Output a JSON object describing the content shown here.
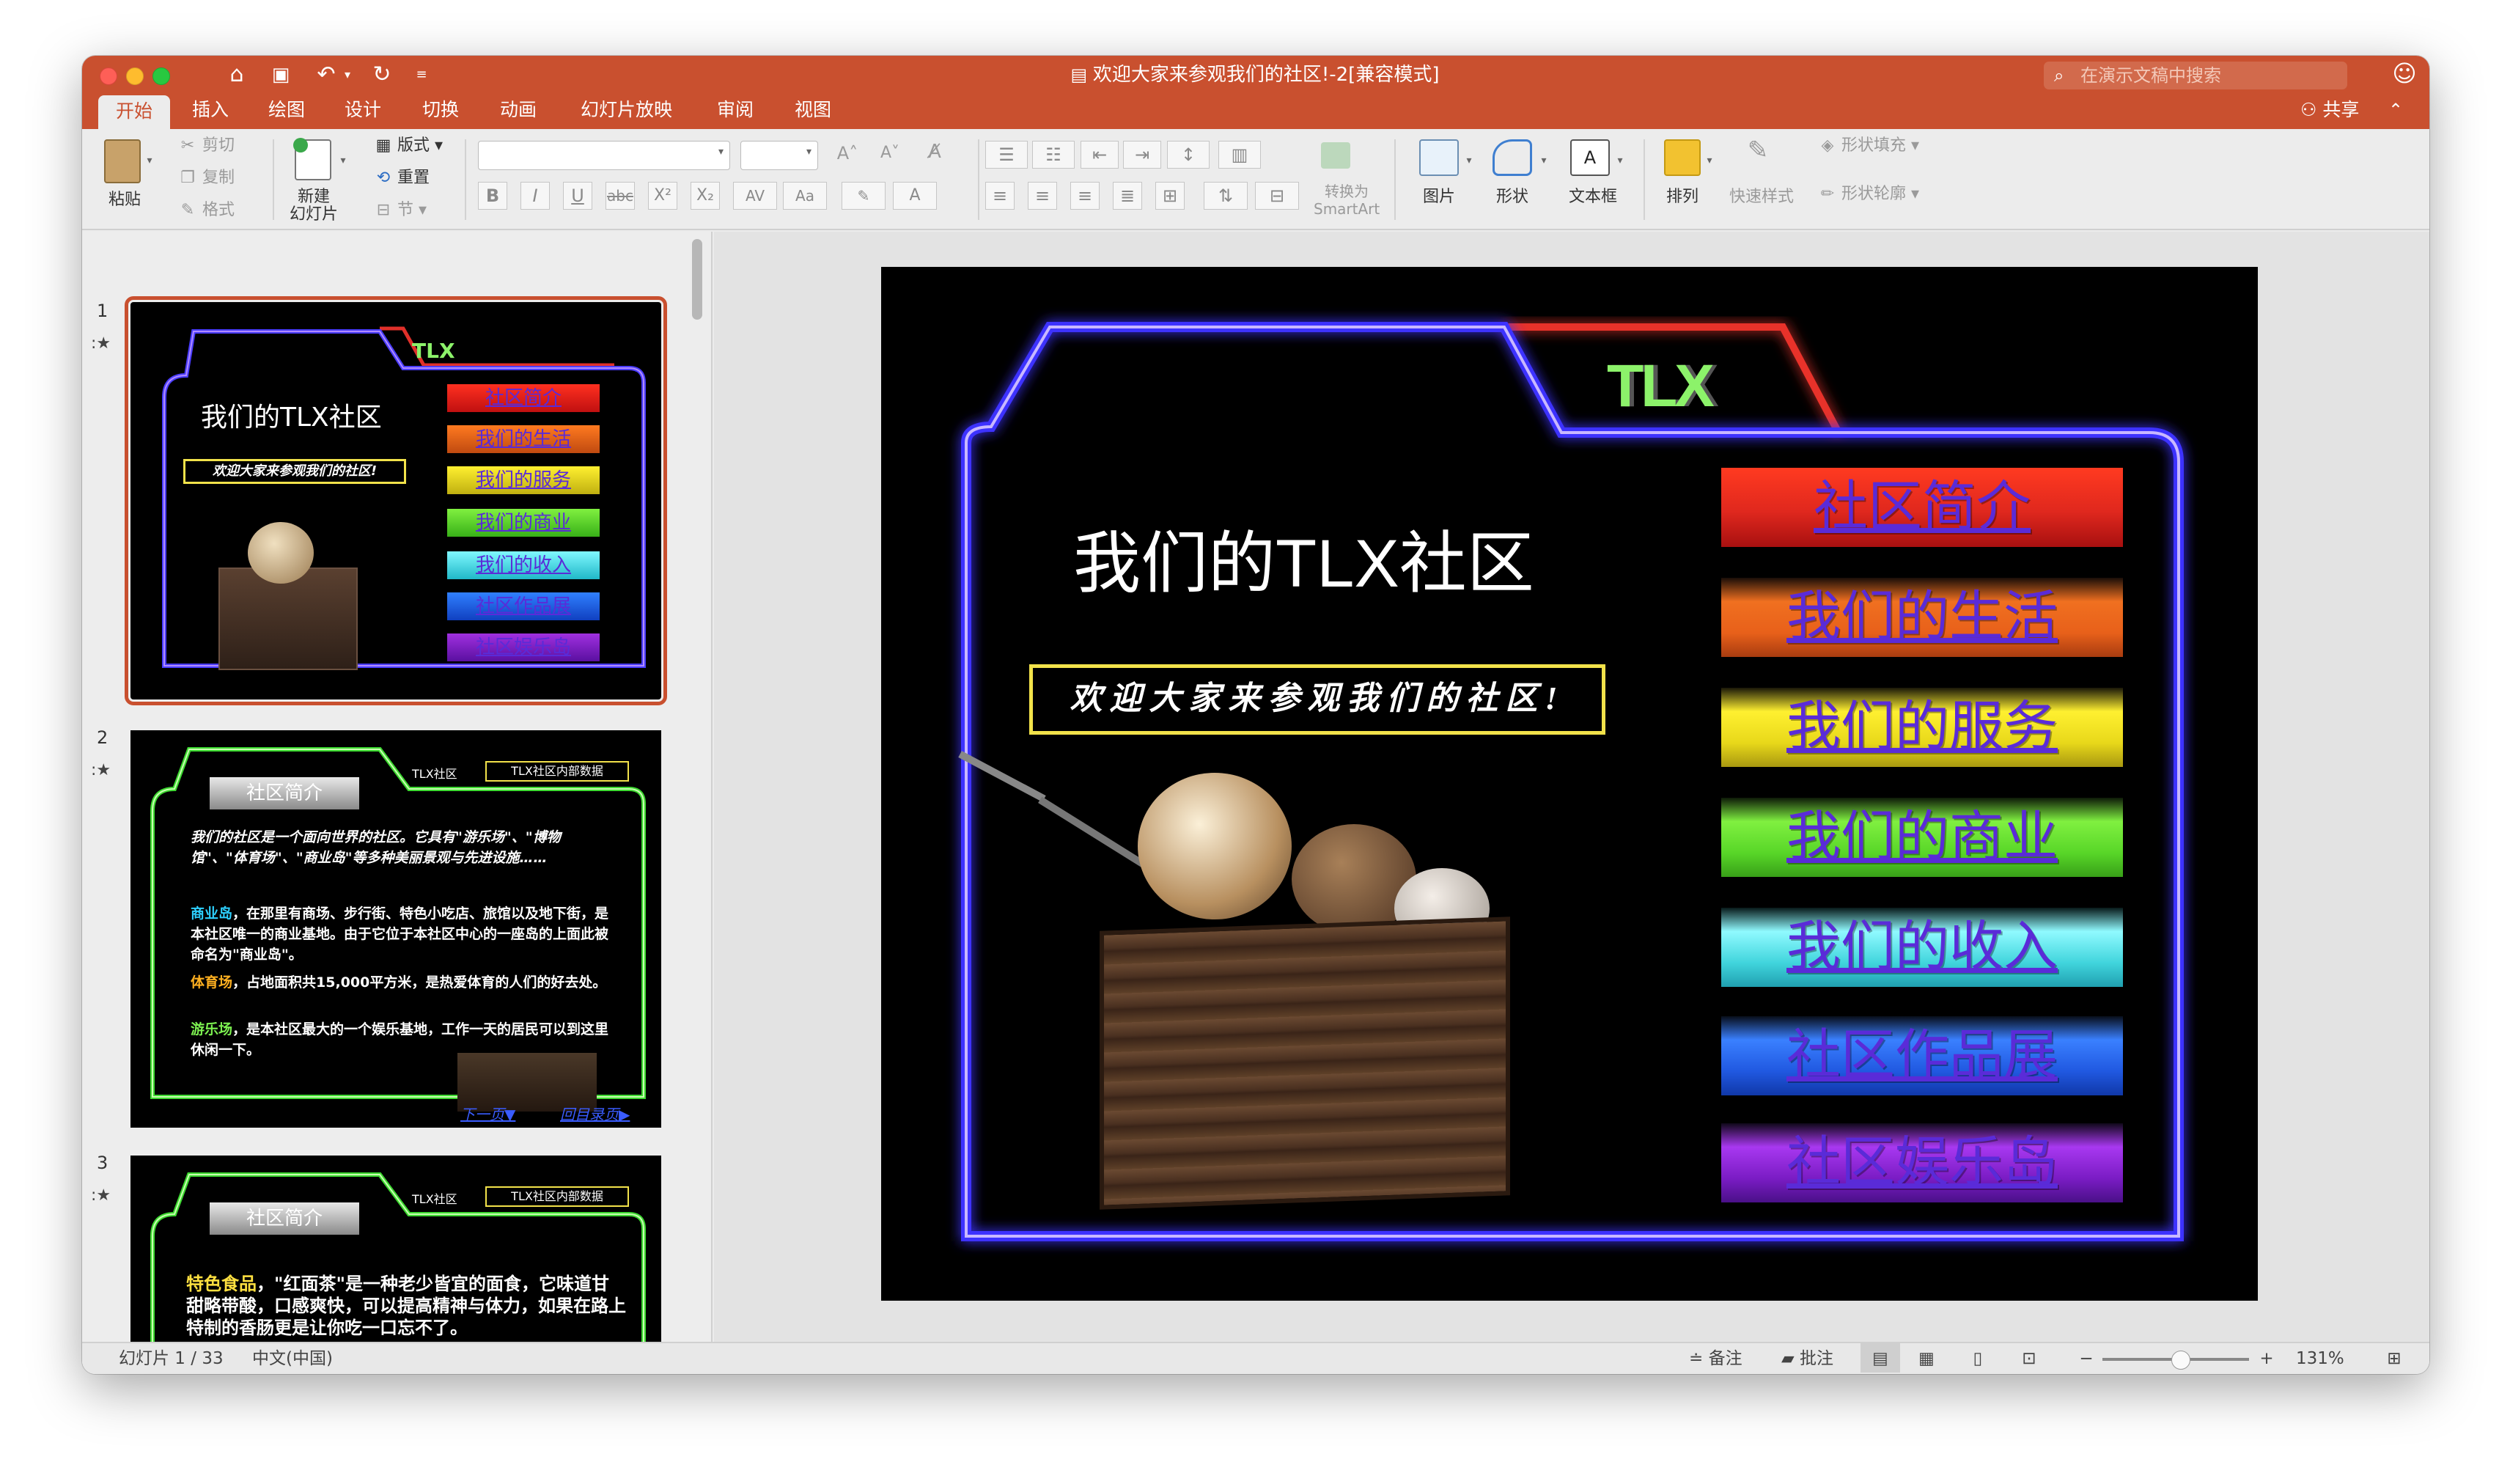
{
  "window": {
    "title": "欢迎大家来参观我们的社区!-2[兼容模式]",
    "search_placeholder": "在演示文稿中搜索"
  },
  "tabs": [
    "开始",
    "插入",
    "绘图",
    "设计",
    "切换",
    "动画",
    "幻灯片放映",
    "审阅",
    "视图"
  ],
  "share_label": "共享",
  "ribbon": {
    "paste": "粘贴",
    "cut": "剪切",
    "copy": "复制",
    "format": "格式",
    "new_slide_line1": "新建",
    "new_slide_line2": "幻灯片",
    "layout": "版式",
    "reset": "重置",
    "section": "节",
    "convert_line1": "转换为",
    "convert_line2": "SmartArt",
    "picture": "图片",
    "shape": "形状",
    "textbox": "文本框",
    "arrange": "排列",
    "quick_styles": "快速样式",
    "shape_fill": "形状填充",
    "shape_outline": "形状轮廓"
  },
  "thumbnails": [
    {
      "number": "1",
      "tag": "TLX",
      "title": "我们的TLX社区",
      "welcome": "欢迎大家来参观我们的社区!",
      "menu": [
        "社区简介",
        "我们的生活",
        "我们的服务",
        "我们的商业",
        "我们的收入",
        "社区作品展",
        "社区娱乐岛"
      ]
    },
    {
      "number": "2",
      "header": "社区简介",
      "label_a": "TLX社区",
      "label_b": "TLX社区内部数据",
      "intro": "我们的社区是一个面向世界的社区。它具有\"游乐场\"、\"博物馆\"、\"体育场\"、\"商业岛\"等多种美丽景观与先进设施……",
      "p1_head": "商业岛",
      "p1_text": "，在那里有商场、步行街、特色小吃店、旅馆以及地下街，是本社区唯一的商业基地。由于它位于本社区中心的一座岛的上面此被命名为\"商业岛\"。",
      "p2_head": "体育场",
      "p2_text": "，占地面积共15,000平方米，是热爱体育的人们的好去处。",
      "p3_head": "游乐场",
      "p3_text": "，是本社区最大的一个娱乐基地，工作一天的居民可以到这里休闲一下。",
      "nav_next": "下一页",
      "nav_home": "回目录页"
    },
    {
      "number": "3",
      "header": "社区简介",
      "label_a": "TLX社区",
      "label_b": "TLX社区内部数据",
      "p_head": "特色食品",
      "p_text": "，\"红面茶\"是一种老少皆宜的面食，它味道甘甜略带酸，口感爽快，可以提高精神与体力，如果在路上特制的香肠更是让你吃一口忘不了。"
    }
  ],
  "slide": {
    "tag": "TLX",
    "title": "我们的TLX社区",
    "welcome": "欢迎大家来参观我们的社区!",
    "menu": [
      "社区简介",
      "我们的生活",
      "我们的服务",
      "我们的商业",
      "我们的收入",
      "社区作品展",
      "社区娱乐岛"
    ]
  },
  "status": {
    "slide_indicator": "幻灯片 1 / 33",
    "language": "中文(中国)",
    "notes": "备注",
    "comments": "批注",
    "zoom": "131%"
  },
  "colors": {
    "titlebar": "#c9502f",
    "menu_gradients": [
      "#e0281e",
      "#e8601a",
      "#e8d81a",
      "#58d628",
      "#40d4dc",
      "#2058e0",
      "#7a1cc4"
    ]
  }
}
